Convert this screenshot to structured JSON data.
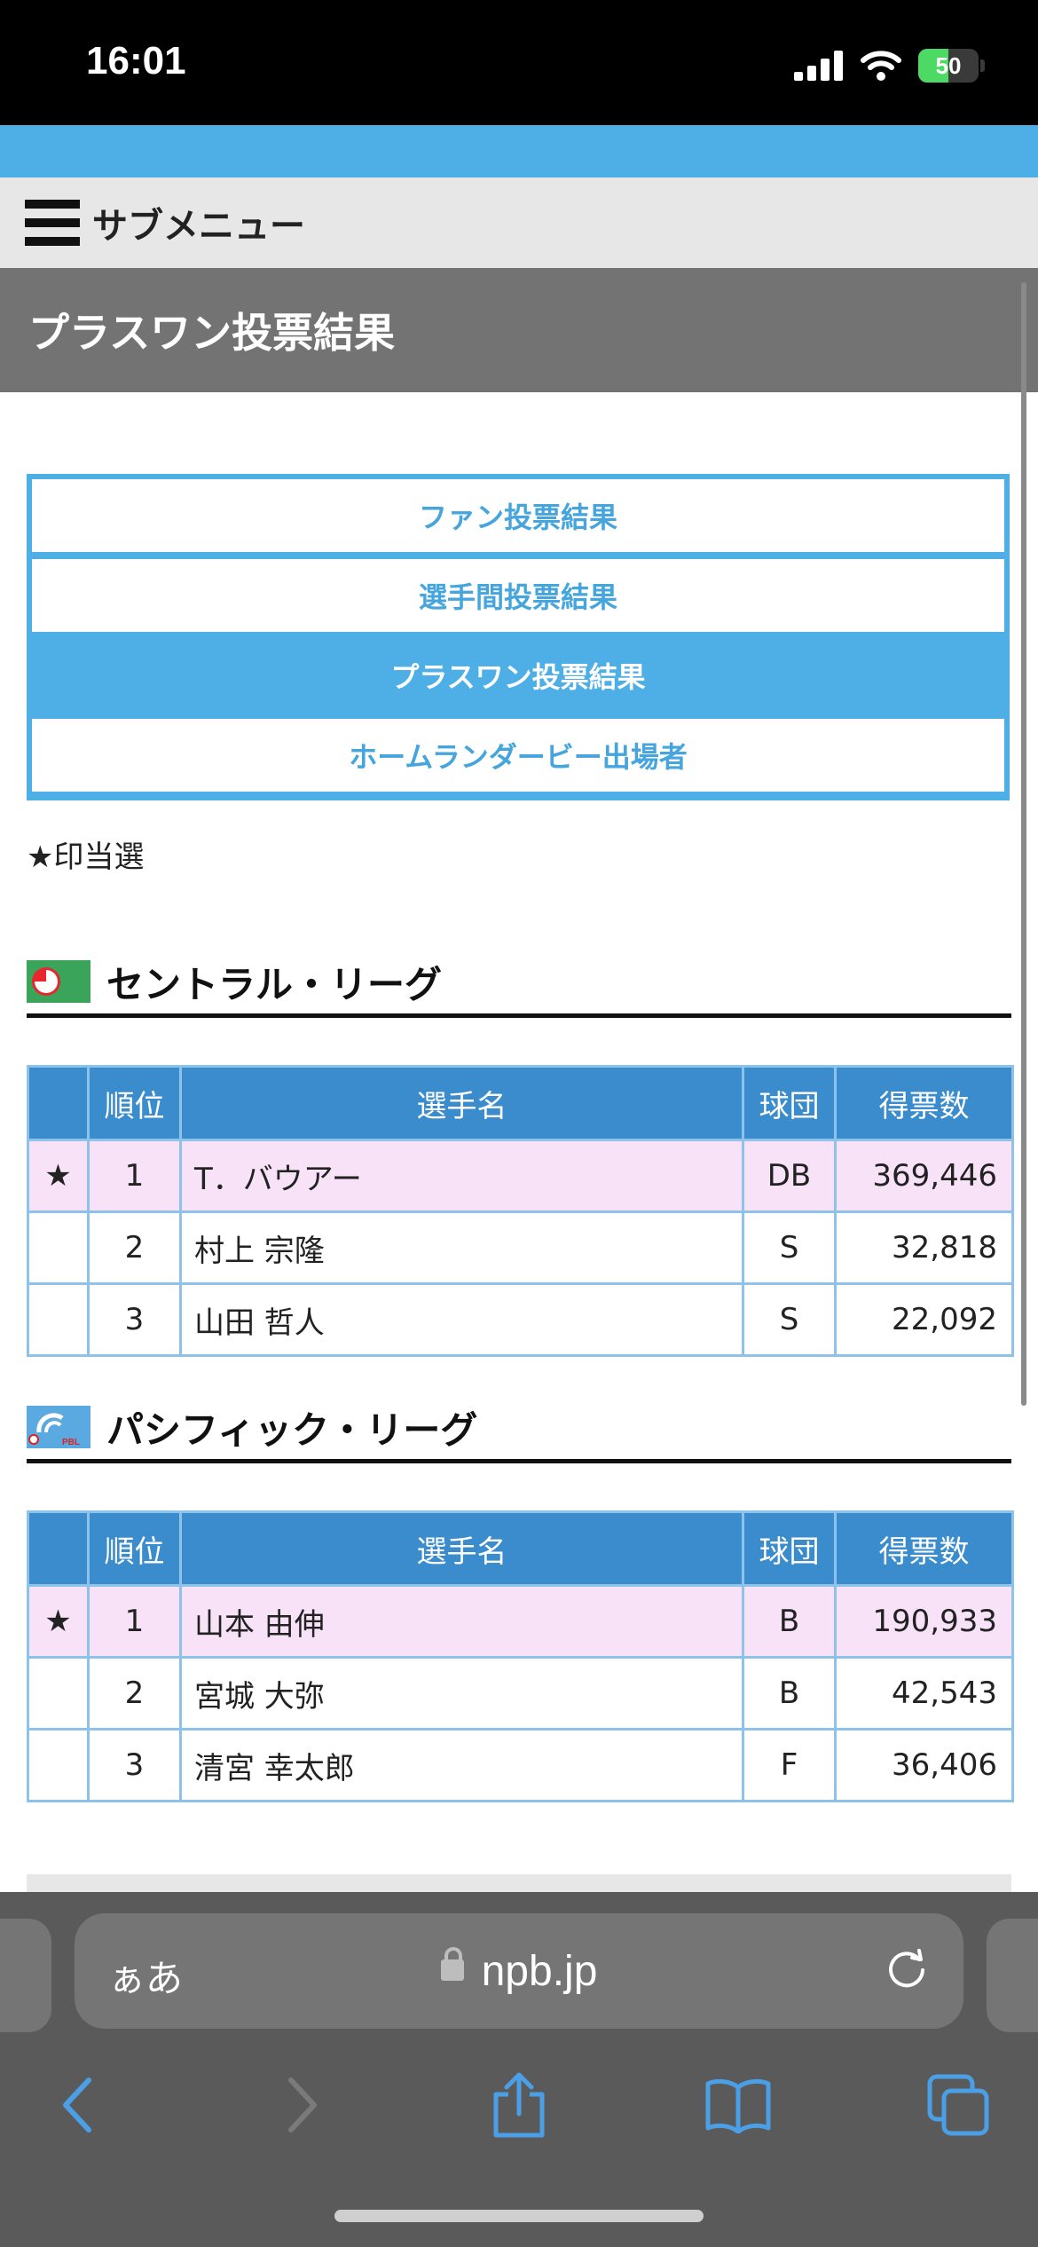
{
  "status_bar": {
    "time": "16:01",
    "battery": "50",
    "battery_level": 0.5
  },
  "submenu": {
    "label": "サブメニュー"
  },
  "page": {
    "title": "プラスワン投票結果"
  },
  "tabs": [
    {
      "label": "ファン投票結果",
      "active": false
    },
    {
      "label": "選手間投票結果",
      "active": false
    },
    {
      "label": "プラスワン投票結果",
      "active": true
    },
    {
      "label": "ホームランダービー出場者",
      "active": false
    }
  ],
  "note": "★印当選",
  "table_headers": [
    "",
    "順位",
    "選手名",
    "球団",
    "得票数"
  ],
  "central": {
    "name": "セントラル・リーグ",
    "rows": [
      {
        "mark": "★",
        "rank": "1",
        "player": "T．バウアー",
        "team": "DB",
        "votes": "369,446"
      },
      {
        "mark": "",
        "rank": "2",
        "player": "村上 宗隆",
        "team": "S",
        "votes": "32,818"
      },
      {
        "mark": "",
        "rank": "3",
        "player": "山田 哲人",
        "team": "S",
        "votes": "22,092"
      }
    ]
  },
  "pacific": {
    "name": "パシフィック・リーグ",
    "logo_text": "PBL",
    "rows": [
      {
        "mark": "★",
        "rank": "1",
        "player": "山本 由伸",
        "team": "B",
        "votes": "190,933"
      },
      {
        "mark": "",
        "rank": "2",
        "player": "宮城 大弥",
        "team": "B",
        "votes": "42,543"
      },
      {
        "mark": "",
        "rank": "3",
        "player": "清宮 幸太郎",
        "team": "F",
        "votes": "36,406"
      }
    ]
  },
  "browser": {
    "aa_label": "ぁあ",
    "url": "npb.jp"
  },
  "colors": {
    "accent": "#4eaee6",
    "table_header": "#3b8ccc",
    "winner_row": "#f8e2f8",
    "page_header": "#737373"
  }
}
